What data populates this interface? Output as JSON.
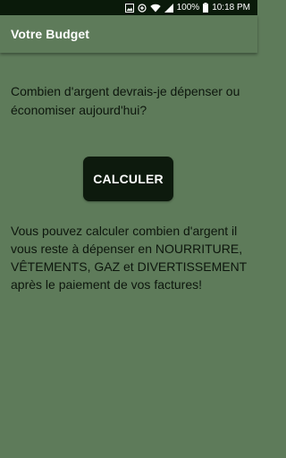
{
  "status_bar": {
    "battery_percent": "100%",
    "time": "10:18 PM",
    "icons": [
      "image-icon",
      "battery-saver-icon",
      "wifi-icon",
      "signal-icon",
      "battery-icon"
    ]
  },
  "app_bar": {
    "title": "Votre Budget"
  },
  "main": {
    "question": "Combien d'argent devrais-je dépenser ou économiser aujourd'hui?",
    "calculate_label": "CALCULER",
    "info": "Vous pouvez calculer combien d'argent il vous reste à dépenser en NOURRITURE, VÊTEMENTS, GAZ et DIVERTISSEMENT après le paiement de vos factures!"
  },
  "colors": {
    "background": "#5e7b5a",
    "status_bar": "#0a1a0a",
    "button": "#0d1a0d",
    "text": "#0d160d"
  }
}
